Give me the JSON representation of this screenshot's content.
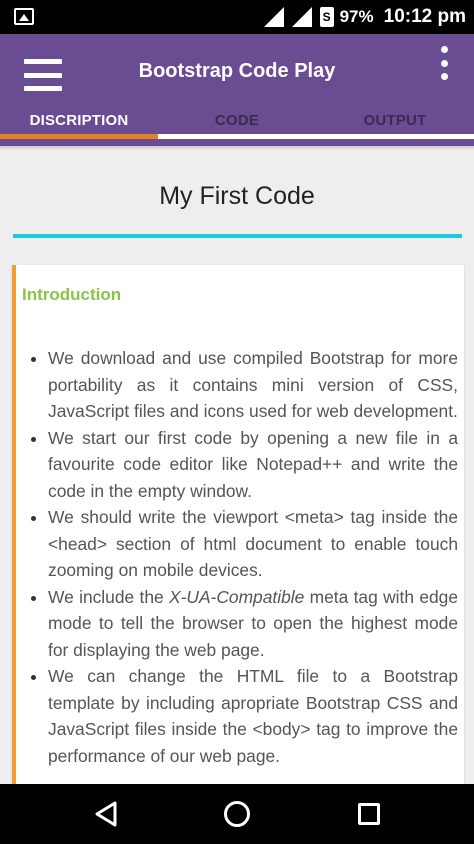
{
  "status_bar": {
    "battery": "97%",
    "time": "10:12 pm",
    "sim_label": "S",
    "icons": [
      "image-notification-icon",
      "signal-icon",
      "signal-icon",
      "sim-icon"
    ]
  },
  "app_bar": {
    "title": "Bootstrap Code Play",
    "color": "#6a4c93"
  },
  "tabs": [
    {
      "label": "DISCRIPTION",
      "active": true
    },
    {
      "label": "CODE",
      "active": false
    },
    {
      "label": "OUTPUT",
      "active": false
    }
  ],
  "content": {
    "title": "My First Code",
    "section_heading": "Introduction",
    "accent_colors": {
      "indicator": "#e67e22",
      "title_rule": "#1fc8d8",
      "heading": "#8bc34a"
    }
  },
  "bullets": [
    {
      "before": "We download and use compiled Bootstrap for more portability as it contains mini version of CSS, JavaScript files and icons used for web development.",
      "em": "",
      "after": ""
    },
    {
      "before": "We start our first code by opening a new file in a favourite code editor like Notepad++ and write the code in the empty window.",
      "em": "",
      "after": ""
    },
    {
      "before": "We should write the viewport <meta> tag inside the <head> section of html document to enable touch zooming on mobile devices.",
      "em": "",
      "after": ""
    },
    {
      "before": "We include the ",
      "em": "X-UA-Compatible",
      "after": " meta tag with edge mode to tell the browser to open the highest mode for displaying the web page."
    },
    {
      "before": "We can change the HTML file to a Bootstrap template by including apropriate Bootstrap CSS and JavaScript files inside the <body> tag to improve the performance of our web page.",
      "em": "",
      "after": ""
    }
  ],
  "nav_bar": {
    "icons": [
      "back-icon",
      "home-icon",
      "recents-icon"
    ]
  }
}
